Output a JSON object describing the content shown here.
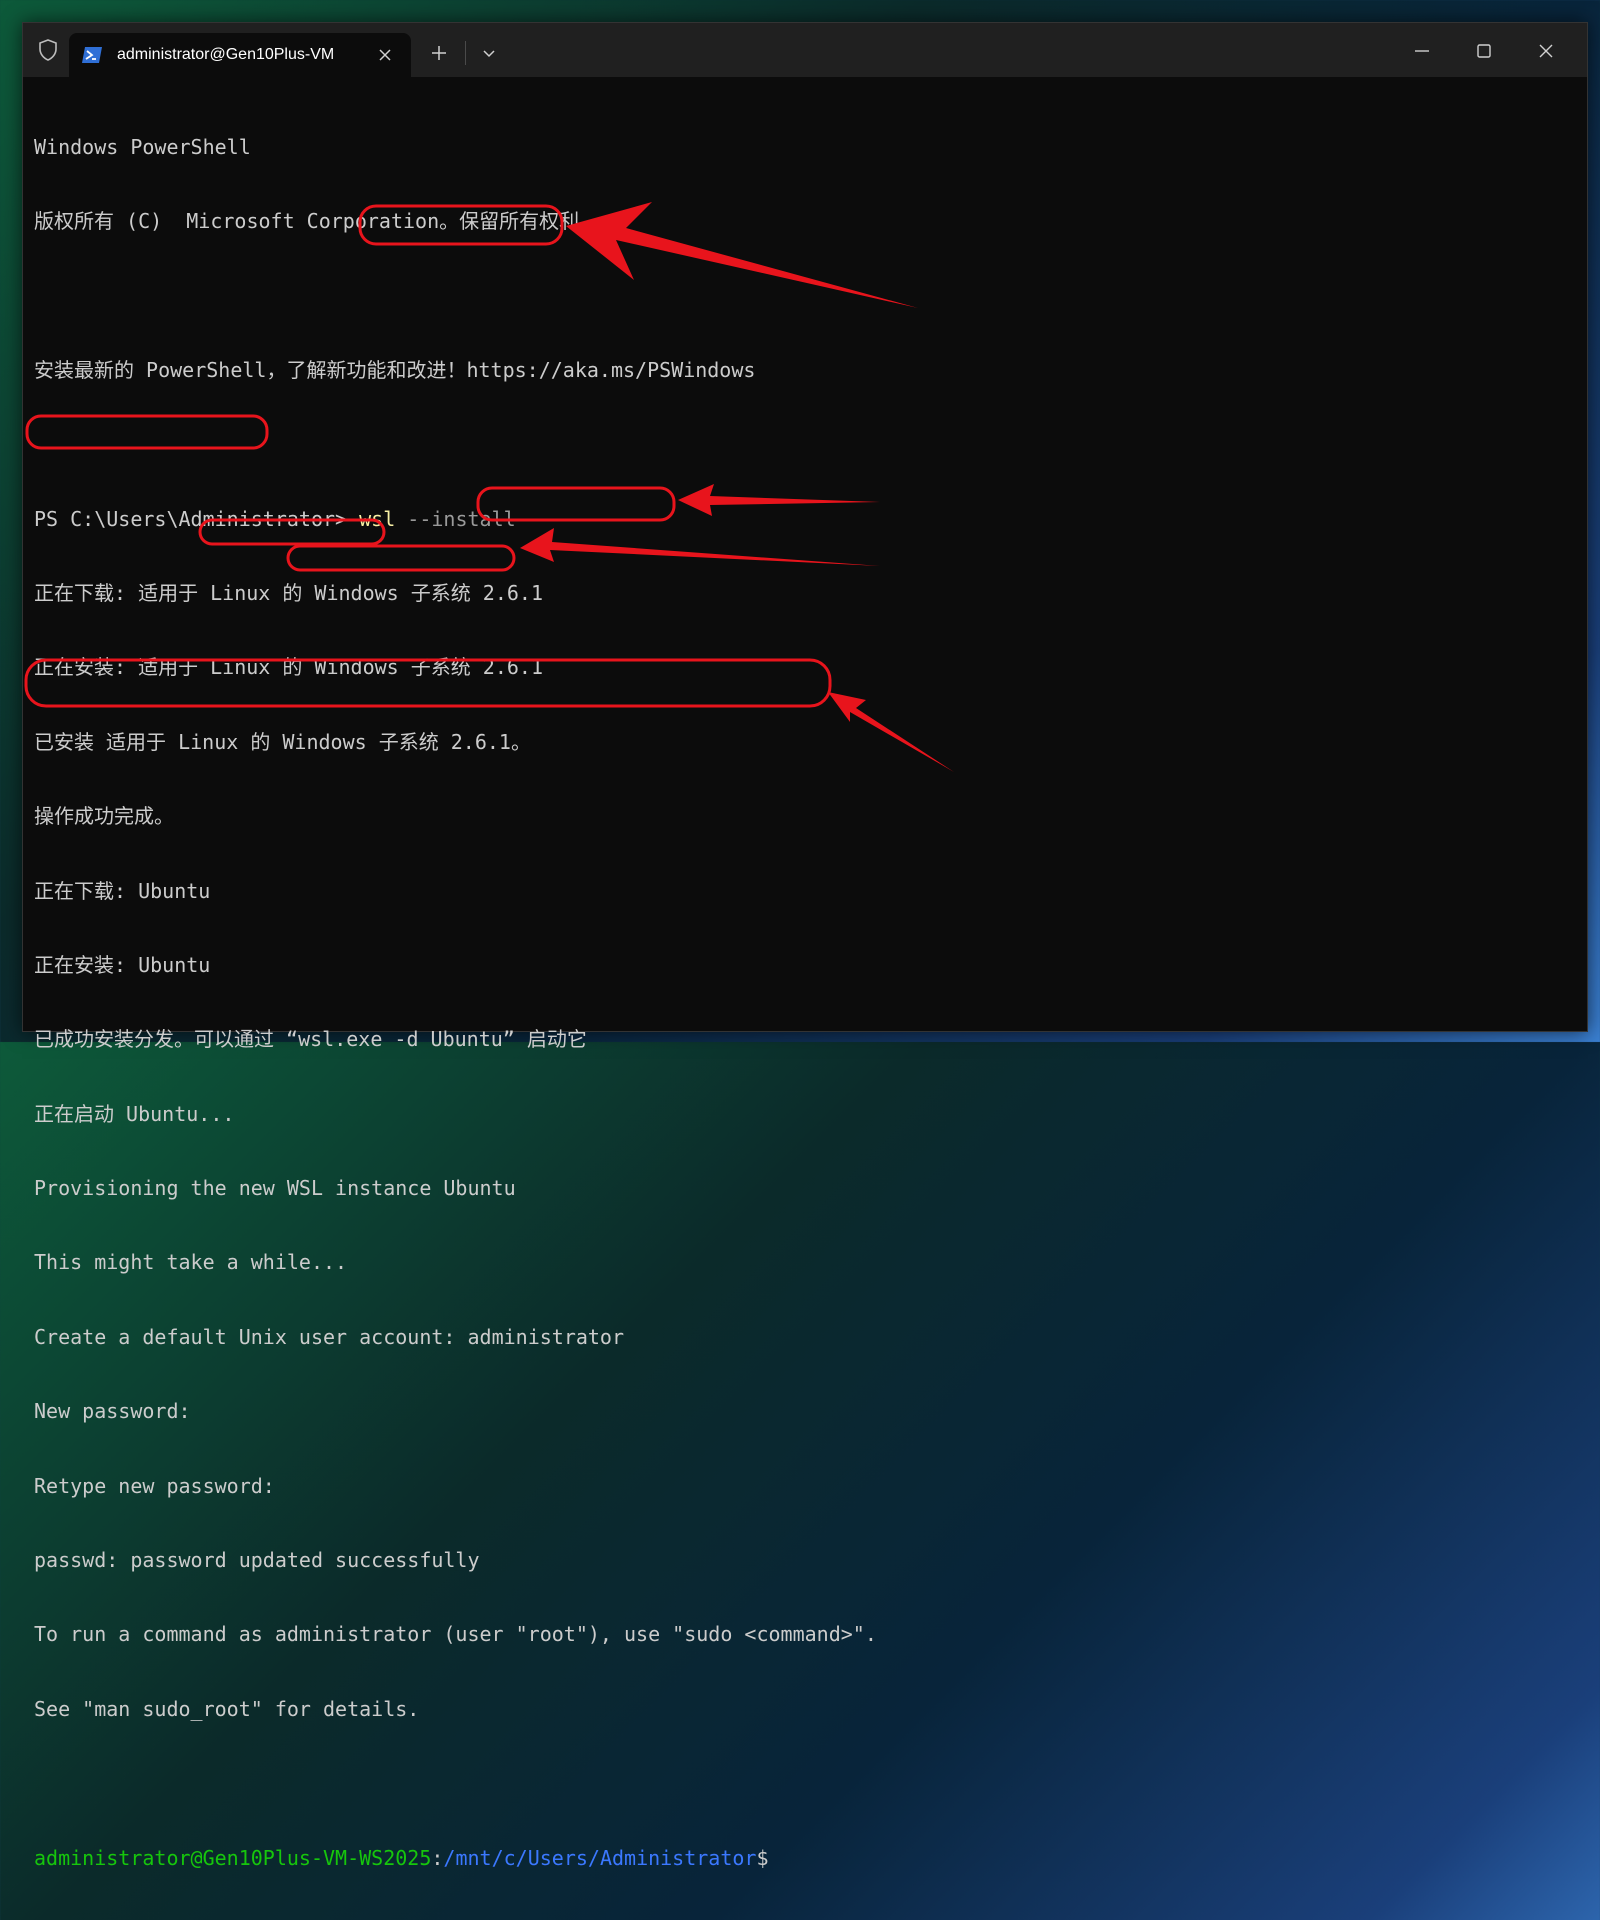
{
  "titlebar": {
    "tab_title": "administrator@Gen10Plus-VM",
    "icons": [
      "shield-icon",
      "powershell-icon",
      "close-icon",
      "plus-icon",
      "chevron-down-icon",
      "minimize-icon",
      "maximize-icon",
      "window-close-icon"
    ]
  },
  "terminal": {
    "lines": [
      "Windows PowerShell",
      "版权所有 (C)  Microsoft Corporation。保留所有权利。",
      "",
      "安装最新的 PowerShell，了解新功能和改进！https://aka.ms/PSWindows",
      "",
      "PS C:\\Users\\Administrator> ",
      "正在下载: 适用于 Linux 的 Windows 子系统 2.6.1",
      "正在安装: 适用于 Linux 的 Windows 子系统 2.6.1",
      "已安装 适用于 Linux 的 Windows 子系统 2.6.1。",
      "操作成功完成。",
      "正在下载: Ubuntu",
      "正在安装: Ubuntu",
      "已成功安装分发。可以通过 “wsl.exe -d Ubuntu” 启动它",
      "正在启动 Ubuntu...",
      "Provisioning the new WSL instance Ubuntu",
      "This might take a while...",
      "Create a default Unix user account: ",
      "New password:",
      "Retype new password:",
      "passwd: password updated successfully",
      "To run a command as administrator (user \"root\"), use \"sudo <command>\".",
      "See \"man sudo_root\" for details.",
      ""
    ],
    "command_name": "wsl",
    "command_args": " --install",
    "username_input": "administrator",
    "prompt_user": "administrator@Gen10Plus-VM-WS2025",
    "prompt_sep": ":",
    "prompt_path": "/mnt/c/Users/Administrator",
    "prompt_symbol": "$"
  },
  "colors": {
    "annotation": "#e8141c",
    "prompt_user": "#16c60c",
    "prompt_path": "#3b78ff",
    "command": "#f9f1a5"
  }
}
